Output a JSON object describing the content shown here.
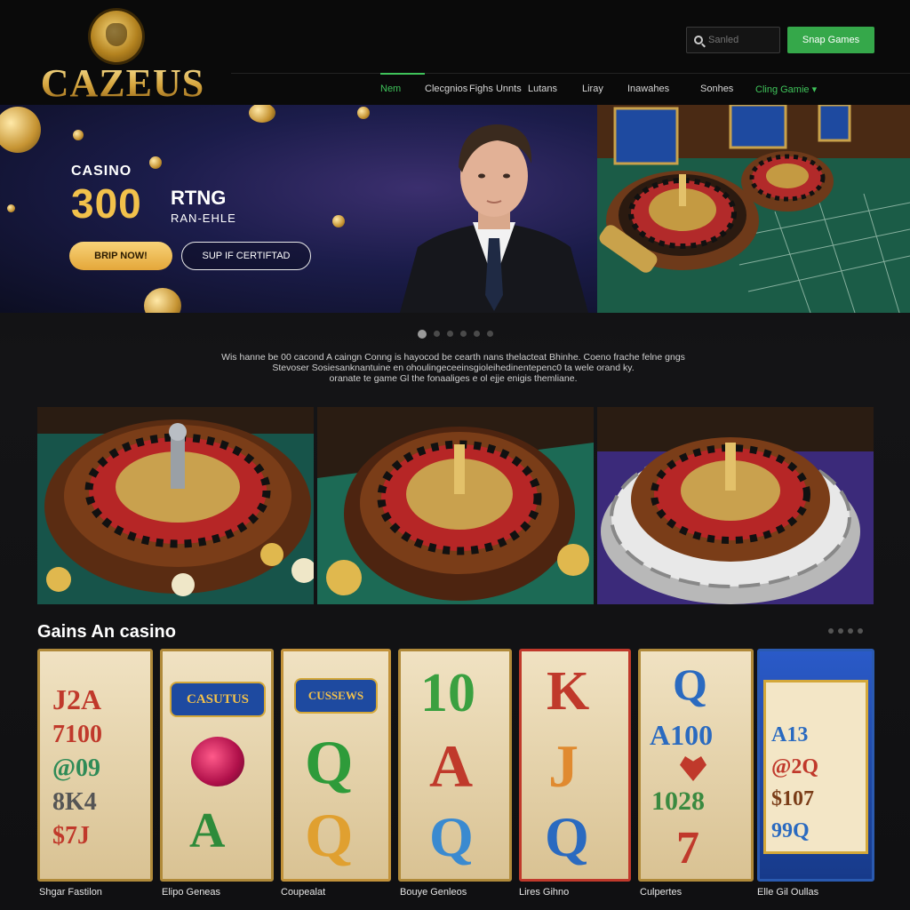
{
  "brand": {
    "name": "CAZEUS"
  },
  "header": {
    "search_label": "Sanled",
    "signup_label": "Snap Games",
    "nav": [
      {
        "label": "Nem",
        "active": true
      },
      {
        "label": "Clecgnios"
      },
      {
        "label": "Fighs Unnts"
      },
      {
        "label": "Lutans"
      },
      {
        "label": "Liray"
      },
      {
        "label": "Inawahes"
      },
      {
        "label": "Sonhes"
      },
      {
        "label": "Cling Gamie",
        "accent": true
      }
    ]
  },
  "hero": {
    "kicker": "CASINO",
    "amount": "300",
    "line1": "RTNG",
    "line2": "RAN-EHLE",
    "primary_button": "BRIP NOW!",
    "secondary_button": "SUP IF CERTIFTAD",
    "slide_count": 6,
    "active_slide": 0
  },
  "intro": {
    "lines": [
      "Wis hanne be 00 cacond A caingn Conng is hayocod be cearth nans thelacteat Bhinhe. Coeno frache felne gngs",
      "Stevoser Sosiesanknantuine en ohoulingeceeinsgioleihedinentepenc0 ta wele orand ky.",
      "oranate te game Gl the fonaaliges e ol ejje enigis themliane."
    ]
  },
  "games_section": {
    "title": "Gains An casino",
    "cards": [
      {
        "label": "Shgar Fastilon"
      },
      {
        "label": "Elipo Geneas"
      },
      {
        "label": "Coupealat"
      },
      {
        "label": "Bouye Genleos"
      },
      {
        "label": "Lires Gihno"
      },
      {
        "label": "Culpertes"
      },
      {
        "label": "Elle Gil Oullas"
      }
    ]
  },
  "colors": {
    "accent_green": "#35a84a",
    "gold": "#f2c14b",
    "background": "#101012"
  }
}
